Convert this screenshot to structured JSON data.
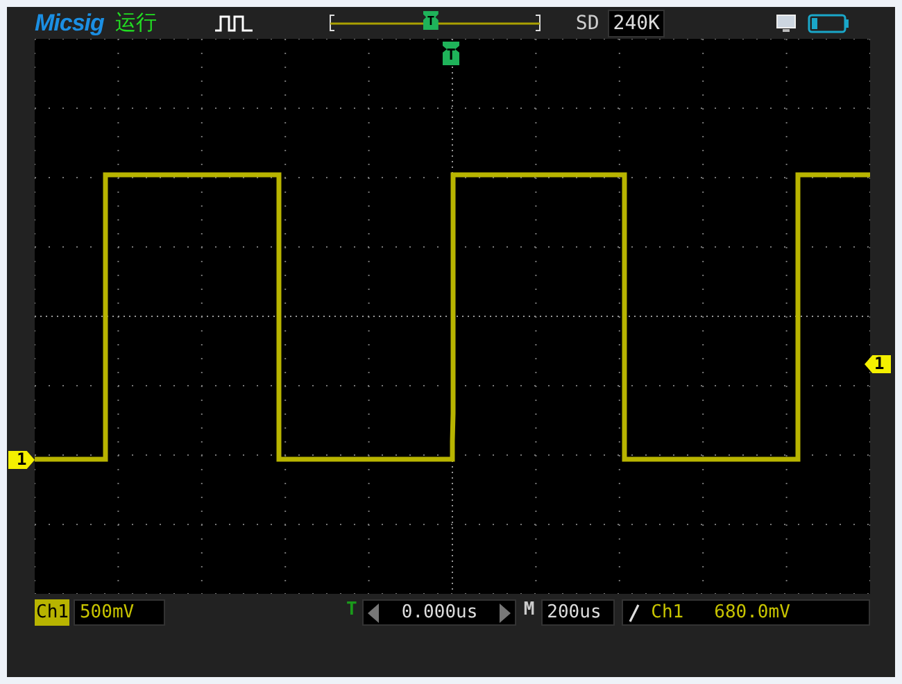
{
  "header": {
    "brand": "Micsig",
    "run_state": "运行",
    "sample_mode": "SD",
    "sample_depth": "240K",
    "trigger_marker": "T"
  },
  "screen": {
    "trigger_marker": "T",
    "channel_marker": "1",
    "trigger_level_marker": "1"
  },
  "footer": {
    "channel_label": "Ch1",
    "channel_scale": "500mV",
    "trigger_label": "T",
    "trigger_offset": "0.000us",
    "timebase_label": "M",
    "timebase": "200us",
    "trigger_source": "Ch1",
    "trigger_level": "680.0mV"
  }
}
